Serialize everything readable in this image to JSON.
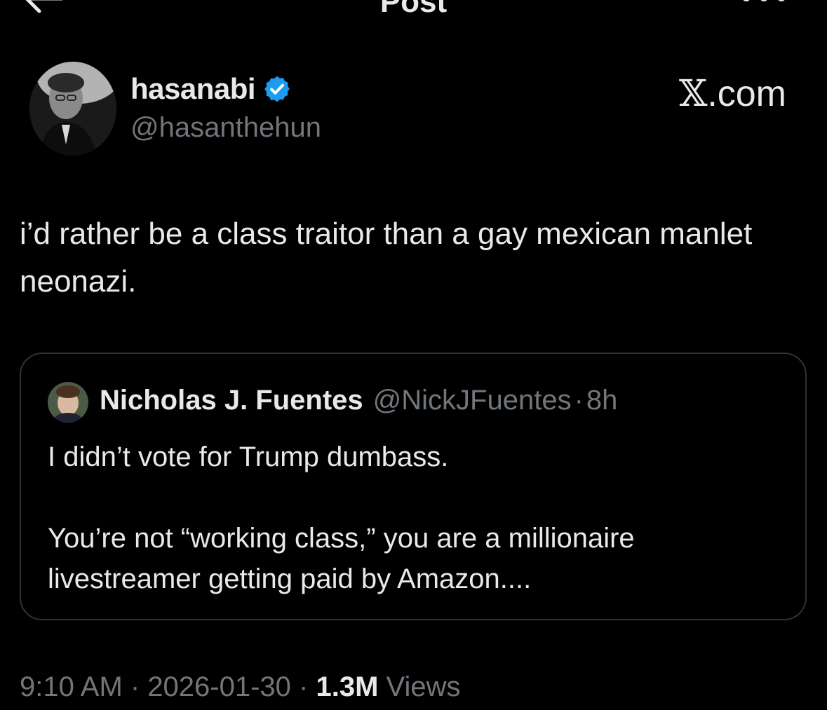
{
  "nav": {
    "title": "Post",
    "back_icon": "arrow-left-icon",
    "more_icon": "more-dots-icon"
  },
  "author": {
    "name": "hasanabi",
    "handle": "@hasanthehun",
    "verified_icon": "verified-badge-icon",
    "verified_color": "#1d9bf0"
  },
  "brand": {
    "label": "X.com",
    "x_glyph": "𝕏",
    "suffix": ".com"
  },
  "post": {
    "text": "i’d rather be a class traitor than a gay mexican manlet neonazi."
  },
  "quote": {
    "name": "Nicholas J. Fuentes",
    "handle": "@NickJFuentes",
    "separator": "·",
    "time": "8h",
    "text": "I didn’t vote for Trump dumbass.\n\nYou’re not “working class,” you are a millionaire livestreamer getting paid by Amazon...."
  },
  "meta": {
    "time": "9:10 AM",
    "sep1": " · ",
    "date": "2026-01-30",
    "sep2": " · ",
    "views_count": "1.3M",
    "views_label": " Views"
  }
}
